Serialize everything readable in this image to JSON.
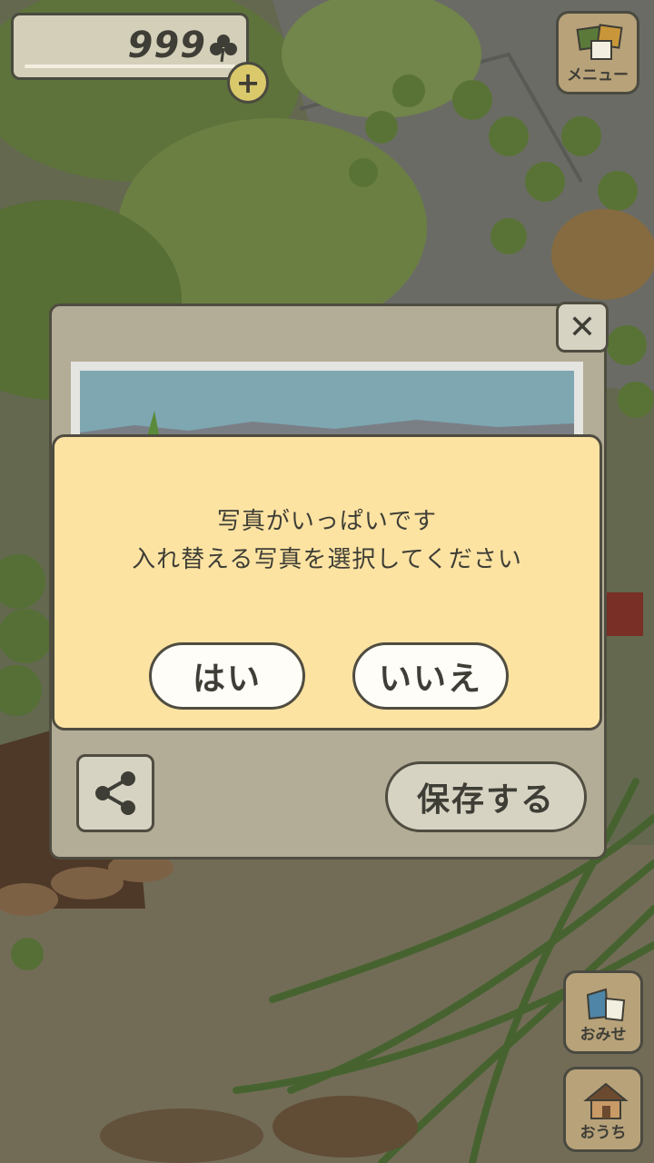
{
  "hud": {
    "clover_count": "999",
    "clover_icon": "clover-icon",
    "add_icon": "plus-icon",
    "menu_label": "メニュー",
    "shop_label": "おみせ",
    "home_label": "おうち"
  },
  "photo_panel": {
    "close_icon": "close-icon",
    "share_icon": "share-icon",
    "save_label": "保存する"
  },
  "dialog": {
    "line1": "写真がいっぱいです",
    "line2": "入れ替える写真を選択してください",
    "yes_label": "はい",
    "no_label": "いいえ"
  },
  "colors": {
    "dialog_bg": "#fde3a2",
    "panel_bg": "#b3ac96",
    "button_bg": "#fffdf8",
    "outline": "#4f4c40"
  }
}
